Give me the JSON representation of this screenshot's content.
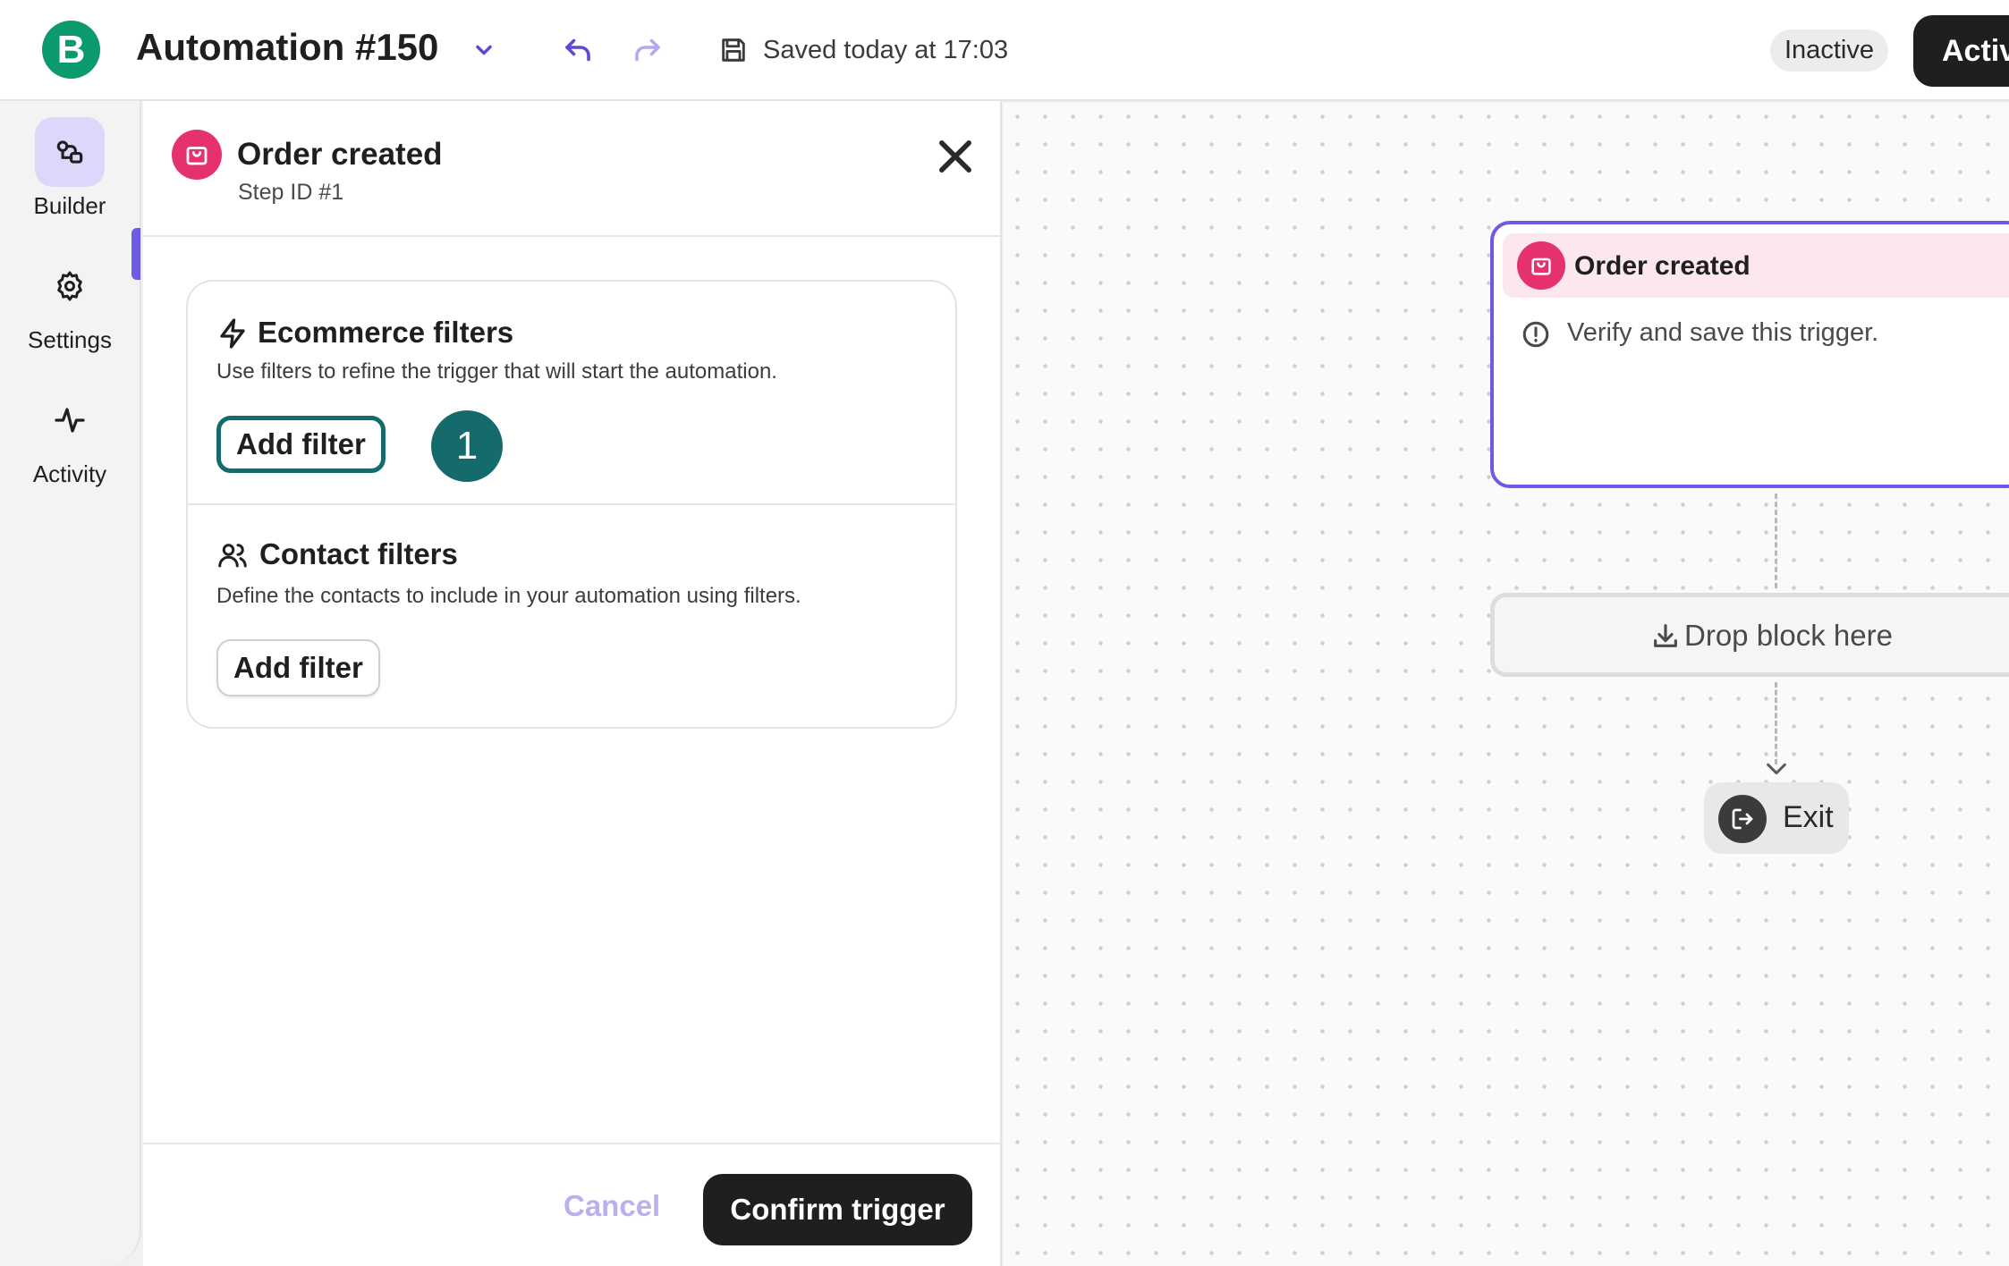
{
  "header": {
    "logo_letter": "B",
    "title": "Automation #150",
    "saved_status": "Saved today at 17:03",
    "status_badge": "Inactive",
    "activate_label": "Activate"
  },
  "rail": {
    "items": [
      {
        "label": "Builder",
        "icon": "builder-icon",
        "active": true
      },
      {
        "label": "Settings",
        "icon": "gear-icon",
        "active": false
      },
      {
        "label": "Activity",
        "icon": "activity-icon",
        "active": false
      }
    ]
  },
  "panel": {
    "title": "Order created",
    "subtitle": "Step ID #1",
    "ecommerce": {
      "title": "Ecommerce filters",
      "description": "Use filters to refine the trigger that will start the automation.",
      "button": "Add filter",
      "step_number": "1"
    },
    "contact": {
      "title": "Contact filters",
      "description": "Define the contacts to include in your automation using filters.",
      "button": "Add filter"
    },
    "footer": {
      "cancel": "Cancel",
      "confirm": "Confirm trigger"
    }
  },
  "canvas": {
    "trigger_title": "Order created",
    "trigger_message": "Verify and save this trigger.",
    "drop_zone": "Drop block here",
    "exit_label": "Exit"
  },
  "colors": {
    "brand_green": "#0b996e",
    "accent_purple": "#6d5be5",
    "trigger_pink": "#e6316f",
    "highlight_teal": "#156a6c"
  }
}
